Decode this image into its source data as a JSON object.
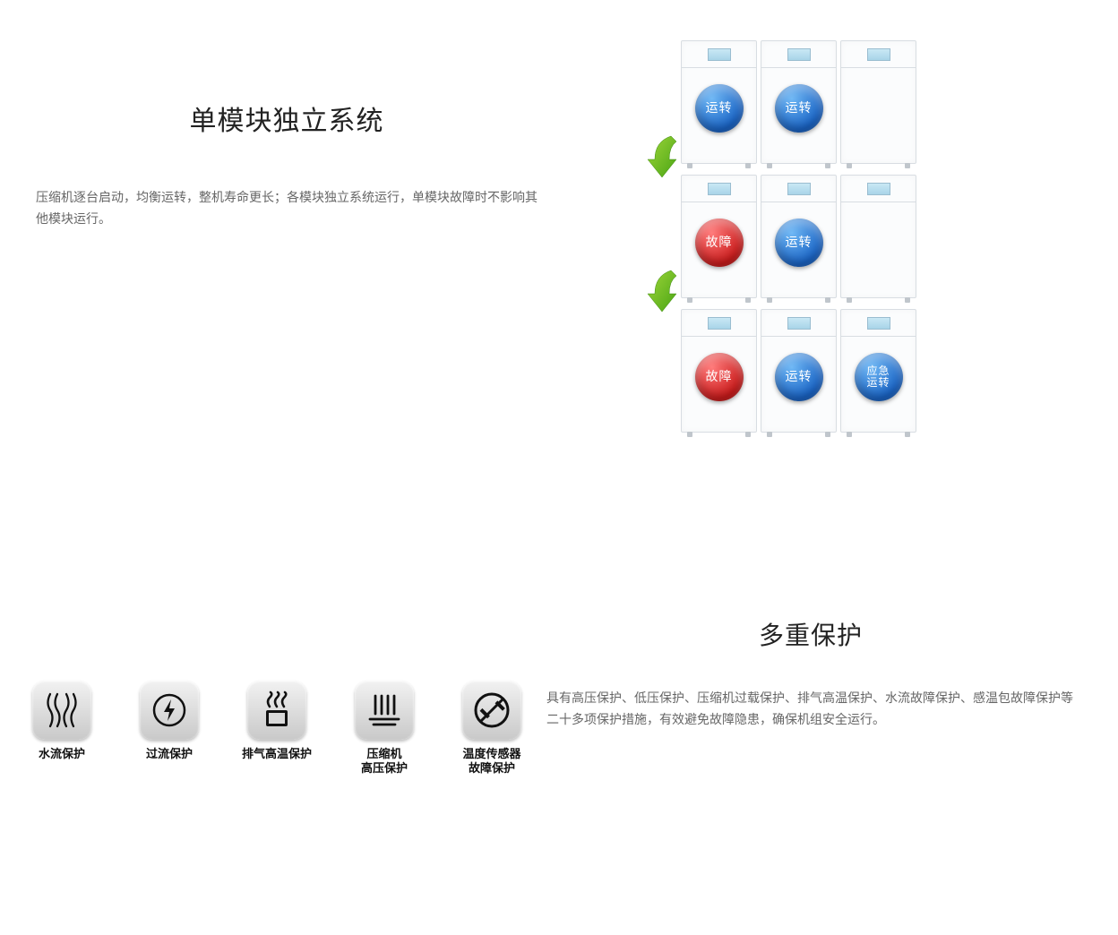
{
  "section1": {
    "title": "单模块独立系统",
    "desc": "压缩机逐台启动，均衡运转，整机寿命更长；各模块独立系统运行，单模块故障时不影响其他模块运行。",
    "rows": [
      [
        {
          "label": "运转",
          "color": "blue"
        },
        {
          "label": "运转",
          "color": "blue"
        },
        {
          "label": "",
          "color": ""
        }
      ],
      [
        {
          "label": "故障",
          "color": "red"
        },
        {
          "label": "运转",
          "color": "blue"
        },
        {
          "label": "",
          "color": ""
        }
      ],
      [
        {
          "label": "故障",
          "color": "red"
        },
        {
          "label": "运转",
          "color": "blue"
        },
        {
          "label": "应急\n运转",
          "color": "blue",
          "small": true
        }
      ]
    ]
  },
  "section2": {
    "title": "多重保护",
    "desc": "具有高压保护、低压保护、压缩机过载保护、排气高温保护、水流故障保护、感温包故障保护等二十多项保护措施，有效避免故障隐患，确保机组安全运行。",
    "icons": [
      {
        "name": "flow-icon",
        "label": "水流保护"
      },
      {
        "name": "overcurrent-icon",
        "label": "过流保护"
      },
      {
        "name": "exhaust-icon",
        "label": "排气高温保护"
      },
      {
        "name": "compressor-icon",
        "label": "压缩机\n高压保护"
      },
      {
        "name": "sensor-icon",
        "label": "温度传感器\n故障保护"
      }
    ]
  }
}
